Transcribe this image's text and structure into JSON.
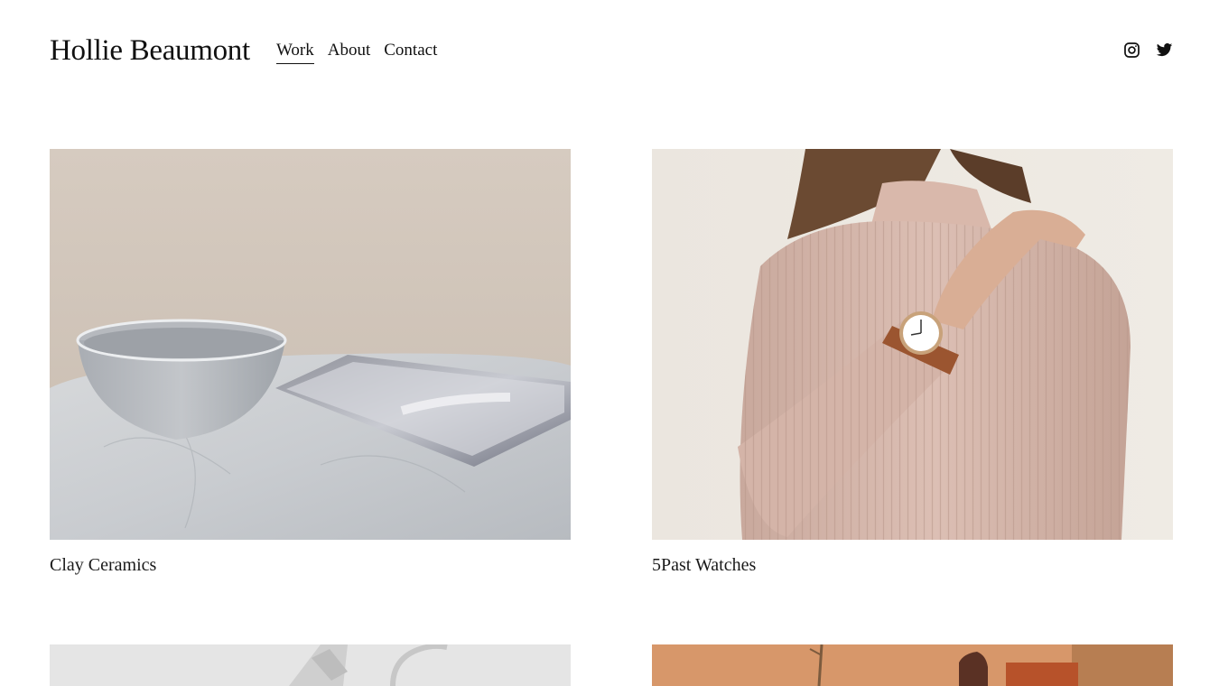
{
  "site": {
    "title": "Hollie Beaumont"
  },
  "nav": {
    "items": [
      {
        "label": "Work",
        "active": true
      },
      {
        "label": "About",
        "active": false
      },
      {
        "label": "Contact",
        "active": false
      }
    ]
  },
  "social": {
    "icons": [
      "instagram-icon",
      "twitter-icon"
    ]
  },
  "projects": [
    {
      "title": "Clay Ceramics",
      "image": "ceramic bowl and marble tray on marble table"
    },
    {
      "title": "5Past Watches",
      "image": "woman in pink ribbed turtleneck wearing watch"
    },
    {
      "title": "",
      "image": "white architectural objects"
    },
    {
      "title": "",
      "image": "orange and tan still life with branch"
    }
  ],
  "colors": {
    "text": "#111111",
    "background": "#ffffff"
  }
}
